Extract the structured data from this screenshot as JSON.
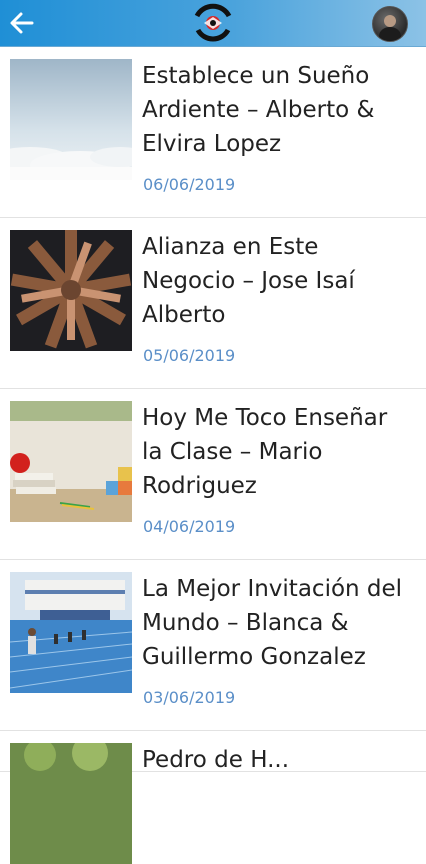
{
  "header": {
    "back_icon": "arrow-left-icon",
    "logo_icon": "vision-sin-limites-logo",
    "avatar_icon": "user-avatar",
    "color_start": "#1f8fd6",
    "color_end": "#8cc2e6"
  },
  "posts": [
    {
      "title": "Establece un Sueño Ardiente – Alberto & Elvira Lopez",
      "date": "06/06/2019",
      "image": "clouds-sky"
    },
    {
      "title": "Alianza en Este Negocio – Jose Isaí Alberto",
      "date": "05/06/2019",
      "image": "hands-together"
    },
    {
      "title": "Hoy Me Toco Enseñar la Clase – Mario Rodriguez",
      "date": "04/06/2019",
      "image": "apple-books-blocks"
    },
    {
      "title": "La Mejor Invitación del Mundo – Blanca & Guillermo Gonzalez",
      "date": "03/06/2019",
      "image": "running-track"
    },
    {
      "title": "Pedro de H...",
      "date": "",
      "image": "trees"
    }
  ],
  "colors": {
    "date": "#5b8fc8",
    "title": "#222222"
  }
}
